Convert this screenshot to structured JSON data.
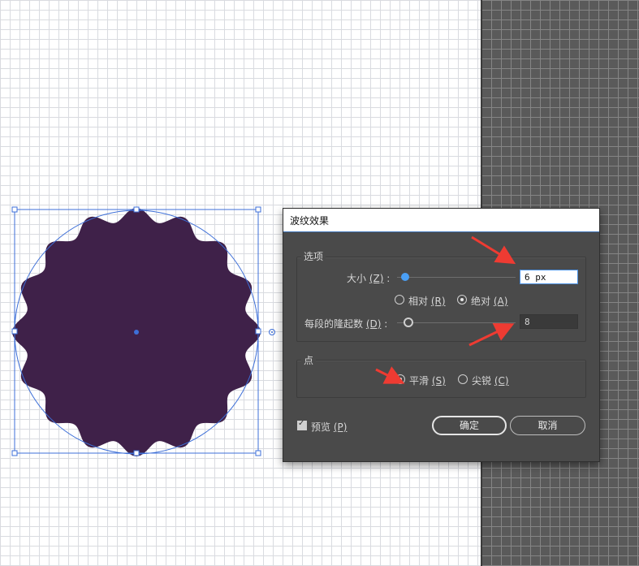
{
  "dialog": {
    "title": "波纹效果",
    "options_group": "选项",
    "size_label": "大小",
    "size_mnemonic": "(Z)",
    "size_value": "6 px",
    "relative_label": "相对",
    "relative_mnemonic": "(R)",
    "absolute_label": "绝对",
    "absolute_mnemonic": "(A)",
    "ridges_label": "每段的隆起数",
    "ridges_mnemonic": "(D)",
    "ridges_value": "8",
    "points_group": "点",
    "smooth_label": "平滑",
    "smooth_mnemonic": "(S)",
    "corner_label": "尖锐",
    "corner_mnemonic": "(C)",
    "preview_label": "预览",
    "preview_mnemonic": "(P)",
    "ok_label": "确定",
    "cancel_label": "取消",
    "preview_checked": true,
    "size_mode": "absolute",
    "point_type": "smooth"
  },
  "canvas": {
    "shape_fill": "#3f2149",
    "selection_color": "#3d6fd8",
    "arrow_color": "#ee3b32"
  }
}
